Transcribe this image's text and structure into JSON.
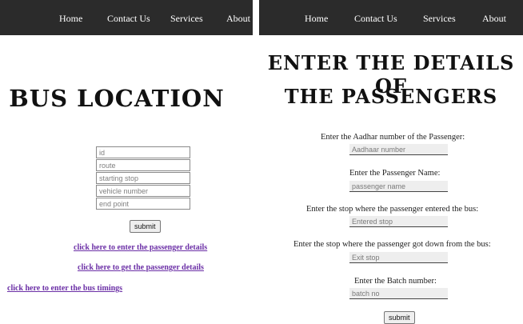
{
  "left": {
    "nav": [
      "Home",
      "Contact Us",
      "Services",
      "About"
    ],
    "title": "BUS LOCATION",
    "fields": [
      {
        "placeholder": "id"
      },
      {
        "placeholder": "route"
      },
      {
        "placeholder": "starting stop"
      },
      {
        "placeholder": "vehicle number"
      },
      {
        "placeholder": "end point"
      }
    ],
    "submit_label": "submit",
    "links": [
      "click here to enter the passenger details",
      "click here to get the passenger details",
      "click here to enter the bus timings"
    ]
  },
  "right": {
    "nav": [
      "Home",
      "Contact Us",
      "Services",
      "About"
    ],
    "title_line1": "ENTER THE DETAILS OF",
    "title_line2": "THE PASSENGERS",
    "fields": [
      {
        "prompt": "Enter the Aadhar number of the Passenger:",
        "placeholder": "Aadhaar number"
      },
      {
        "prompt": "Enter the Passenger Name:",
        "placeholder": "passenger name"
      },
      {
        "prompt": "Enter the stop where the passenger entered the bus:",
        "placeholder": "Entered stop"
      },
      {
        "prompt": "Enter the stop where the passenger got down from the bus:",
        "placeholder": "Exit stop"
      },
      {
        "prompt": "Enter the Batch number:",
        "placeholder": "batch no"
      }
    ],
    "submit_label": "submit"
  },
  "colors": {
    "navbar": "#2b2b2b",
    "link": "#6b2fa6"
  }
}
